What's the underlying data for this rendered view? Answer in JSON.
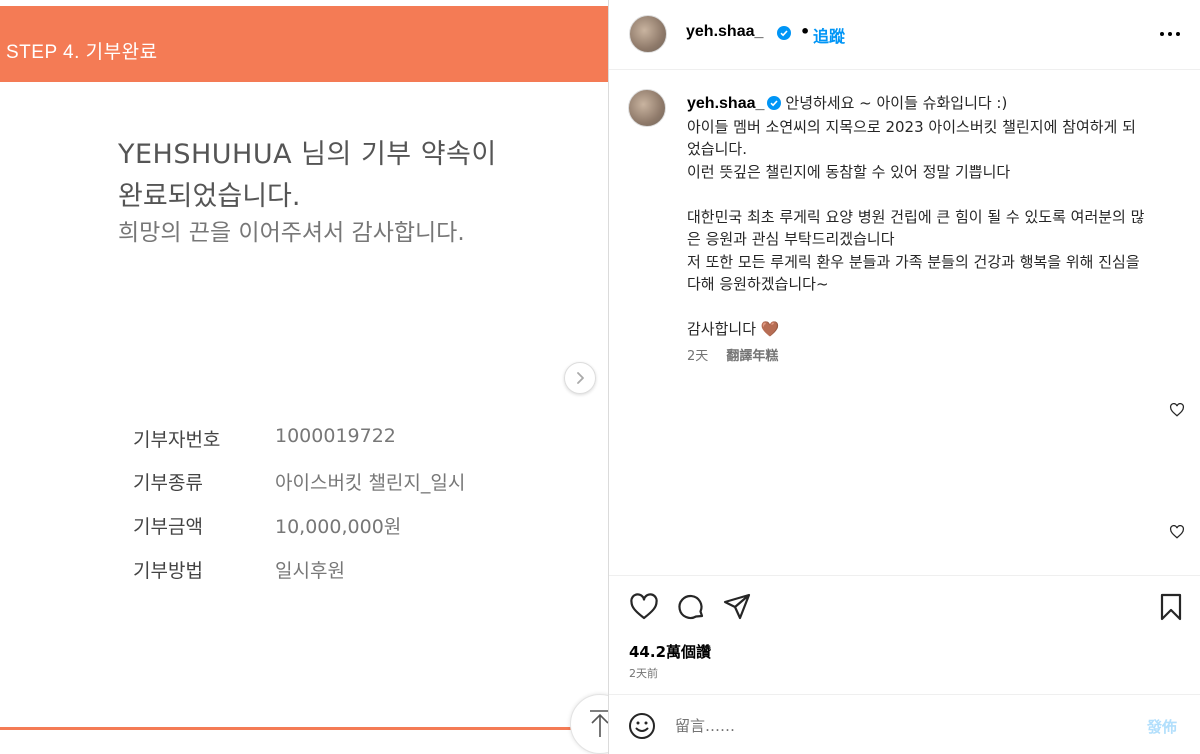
{
  "donation_image": {
    "step_title": "STEP 4. 기부완료",
    "completion_line1": "YEHSHUHUA 님의 기부 약속이",
    "completion_line2": "완료되었습니다.",
    "thanks_line": "희망의 끈을 이어주셔서 감사합니다.",
    "info_rows": [
      {
        "label": "기부자번호",
        "value": "1000019722"
      },
      {
        "label": "기부종류",
        "value": "아이스버킷 챌린지_일시"
      },
      {
        "label": "기부금액",
        "value": "10,000,000원"
      },
      {
        "label": "기부방법",
        "value": "일시후원"
      }
    ]
  },
  "header": {
    "username": "yeh.shaa_",
    "dot": "•",
    "follow_label": "追蹤"
  },
  "caption": {
    "username": "yeh.shaa_",
    "first_line": "안녕하세요 ~ 아이들 슈화입니다 :)",
    "lines": [
      "아이들 멤버 소연씨의 지목으로 2023 아이스버킷 챌린지에 참여하게 되",
      "었습니다.",
      "이런 뜻깊은 챌린지에 동참할 수 있어 정말 기쁩니다",
      "",
      "대한민국 최초 루게릭 요양 병원 건립에 큰 힘이 될 수 있도록 여러분의 많",
      "은 응원과 관심 부탁드리겠습니다",
      "저 또한 모든 루게릭 환우 분들과 가족 분들의 건강과 행복을 위해 진심을",
      "다해 응원하겠습니다~",
      "",
      "감사합니다 🤎"
    ],
    "time": "2天",
    "translate_label": "翻譯年糕"
  },
  "post": {
    "likes": "44.2萬個讚",
    "date": "2天前"
  },
  "comment": {
    "placeholder": "留言……",
    "post_label": "發佈"
  },
  "colors": {
    "accent_orange": "#f47b55",
    "ig_blue": "#0095f6",
    "post_disabled": "#b2dffc"
  },
  "icons": [
    "chevron-right-icon",
    "arrow-up-icon",
    "verified-badge-icon",
    "more-icon",
    "heart-icon",
    "comment-icon",
    "share-icon",
    "bookmark-icon",
    "emoji-icon"
  ]
}
